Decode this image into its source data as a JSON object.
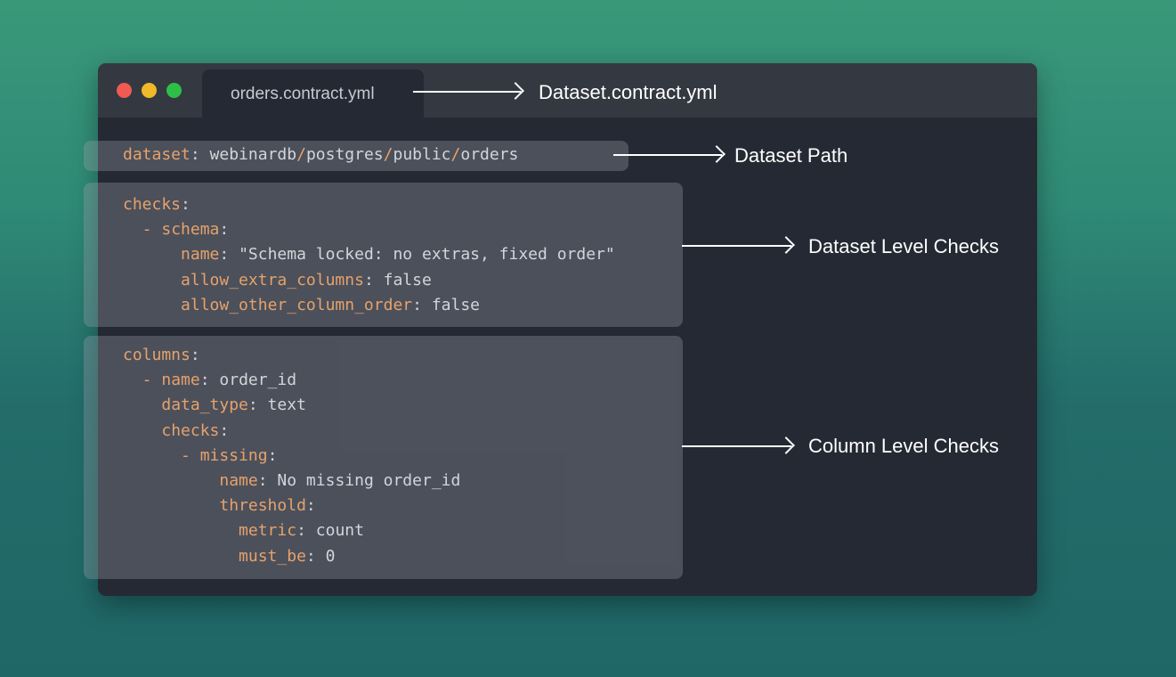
{
  "tab": {
    "filename": "orders.contract.yml"
  },
  "annotations": {
    "file": "Dataset.contract.yml",
    "path": "Dataset Path",
    "dataset_checks": "Dataset Level Checks",
    "column_checks": "Column Level Checks"
  },
  "code": {
    "dataset_key": "dataset",
    "dataset_path": [
      "webinardb",
      "postgres",
      "public",
      "orders"
    ],
    "checks_key": "checks",
    "schema_key": "schema",
    "name_key": "name",
    "schema_name_value": "\"Schema locked: no extras, fixed order\"",
    "allow_extra_key": "allow_extra_columns",
    "allow_extra_value": "false",
    "allow_order_key": "allow_other_column_order",
    "allow_order_value": "false",
    "columns_key": "columns",
    "col_name_value": "order_id",
    "data_type_key": "data_type",
    "data_type_value": "text",
    "col_checks_key": "checks",
    "missing_key": "missing",
    "missing_name_value": "No missing order_id",
    "threshold_key": "threshold",
    "metric_key": "metric",
    "metric_value": "count",
    "must_be_key": "must_be",
    "must_be_value": "0"
  },
  "colors": {
    "key": "#e6a26b",
    "value": "#d3d5da",
    "window": "#252933",
    "titlebar": "#343841",
    "close": "#ef5a52",
    "minimize": "#f0b92a",
    "maximize": "#2dbf47"
  }
}
